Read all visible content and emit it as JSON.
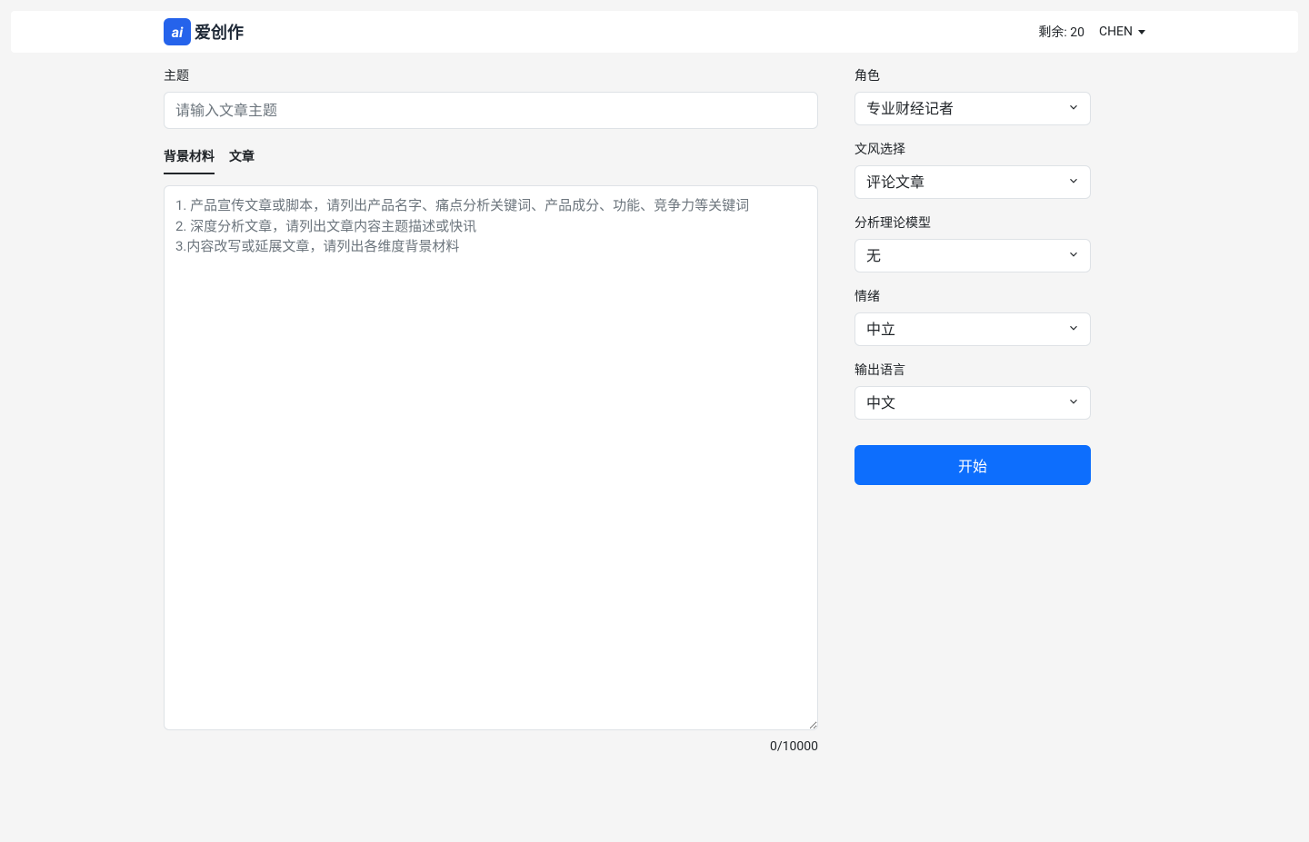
{
  "header": {
    "logo_text": "爱创作",
    "remaining_label": "剩余: 20",
    "username": "CHEN"
  },
  "main": {
    "topic_label": "主题",
    "topic_placeholder": "请输入文章主题",
    "tabs": [
      {
        "label": "背景材料",
        "active": true
      },
      {
        "label": "文章",
        "active": false
      }
    ],
    "textarea_placeholder": "1. 产品宣传文章或脚本，请列出产品名字、痛点分析关键词、产品成分、功能、竞争力等关键词\n2. 深度分析文章，请列出文章内容主题描述或快讯\n3.内容改写或延展文章，请列出各维度背景材料",
    "char_count": "0/10000"
  },
  "sidebar": {
    "role": {
      "label": "角色",
      "value": "专业财经记者"
    },
    "style": {
      "label": "文风选择",
      "value": "评论文章"
    },
    "model": {
      "label": "分析理论模型",
      "value": "无"
    },
    "emotion": {
      "label": "情绪",
      "value": "中立"
    },
    "language": {
      "label": "输出语言",
      "value": "中文"
    },
    "start_button": "开始"
  }
}
